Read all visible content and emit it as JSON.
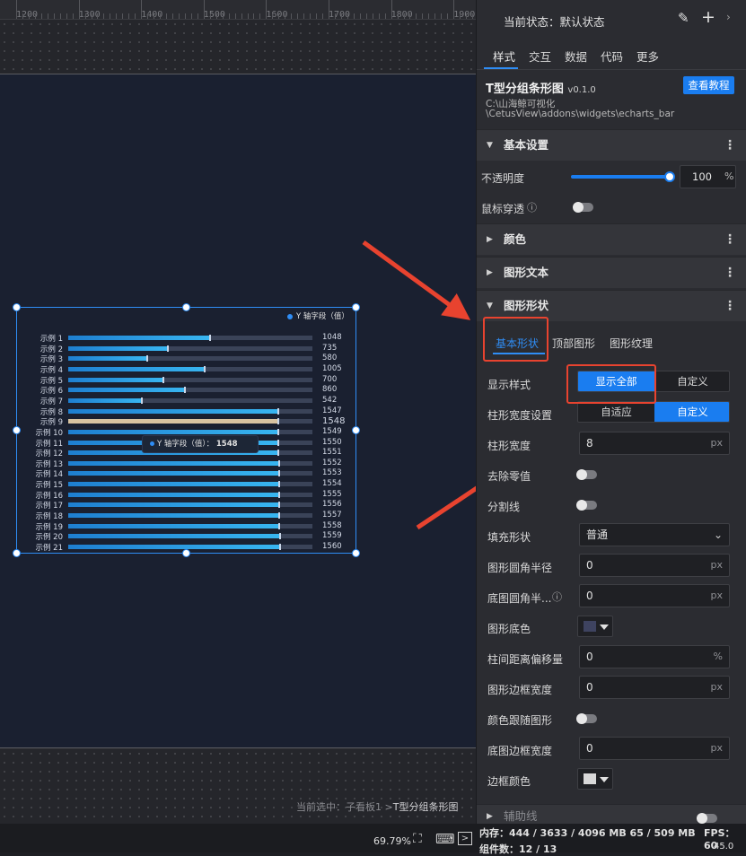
{
  "ruler": {
    "labels": [
      "1200",
      "1300",
      "1400",
      "1500",
      "1600",
      "1700",
      "1800",
      "1900"
    ]
  },
  "chart_data": {
    "type": "bar",
    "series": [
      {
        "name": "Y 轴字段（值）",
        "values": [
          1048,
          735,
          580,
          1005,
          700,
          860,
          542,
          1547,
          1548,
          1549,
          1550,
          1551,
          1552,
          1553,
          1554,
          1555,
          1556,
          1557,
          1558,
          1559,
          1560
        ]
      }
    ],
    "categories": [
      "示例 1",
      "示例 2",
      "示例 3",
      "示例 4",
      "示例 5",
      "示例 6",
      "示例 7",
      "示例 8",
      "示例 9",
      "示例 10",
      "示例 11",
      "示例 12",
      "示例 13",
      "示例 14",
      "示例 15",
      "示例 16",
      "示例 17",
      "示例 18",
      "示例 19",
      "示例 20",
      "示例 21"
    ],
    "xlim": [
      0,
      1800
    ],
    "highlighted_category": "示例 9",
    "legend": "top-right",
    "colors": {
      "bar": "#2f9ee8",
      "highlight": "#d8c3a0",
      "track": "#3a4358"
    }
  },
  "tooltip": {
    "label": "Y 轴字段（值）：",
    "value": "1548"
  },
  "breadcrumb": {
    "prefix": "当前选中：子看板1 >",
    "current": "T型分组条形图"
  },
  "panel": {
    "state_label": "当前状态：默认状态",
    "tabs": [
      "样式",
      "交互",
      "数据",
      "代码",
      "更多"
    ],
    "widget_name": "T型分组条形图",
    "version": "v0.1.0",
    "tutorial_button": "查看教程",
    "path_line1": "C:\\山海鲸可视化",
    "path_line2": "\\CetusView\\addons\\widgets\\echarts_bar",
    "sections": {
      "basic": "基本设置",
      "color": "颜色",
      "text": "图形文本",
      "shape": "图形形状",
      "aux": "辅助线"
    },
    "opacity_label": "不透明度",
    "opacity_value": "100",
    "opacity_unit": "%",
    "mouse_label": "鼠标穿透",
    "subtabs": [
      "基本形状",
      "顶部图形",
      "图形纹理"
    ],
    "rows": {
      "display_style": {
        "label": "显示样式",
        "options": [
          "显示全部",
          "自定义"
        ]
      },
      "bar_width_setting": {
        "label": "柱形宽度设置",
        "options": [
          "自适应",
          "自定义"
        ]
      },
      "bar_width": {
        "label": "柱形宽度",
        "value": "8",
        "unit": "px"
      },
      "remove_zero": {
        "label": "去除零值"
      },
      "divider": {
        "label": "分割线"
      },
      "fill_shape": {
        "label": "填充形状",
        "value": "普通"
      },
      "radius": {
        "label": "图形圆角半径",
        "value": "0",
        "unit": "px"
      },
      "base_radius": {
        "label": "底图圆角半...",
        "value": "0",
        "unit": "px"
      },
      "base_color": {
        "label": "图形底色"
      },
      "offset": {
        "label": "柱间距离偏移量",
        "value": "0",
        "unit": "%"
      },
      "border_width": {
        "label": "图形边框宽度",
        "value": "0",
        "unit": "px"
      },
      "follow_color": {
        "label": "颜色跟随图形"
      },
      "base_border_width": {
        "label": "底图边框宽度",
        "value": "0",
        "unit": "px"
      },
      "border_color": {
        "label": "边框颜色"
      }
    }
  },
  "status": {
    "zoom": "69.79%",
    "memory": "内存：444 / 3633 / 4096 MB  65 / 509 MB",
    "components": "组件数：12 / 13",
    "fps": "FPS：60",
    "fps_small": "45.0"
  }
}
